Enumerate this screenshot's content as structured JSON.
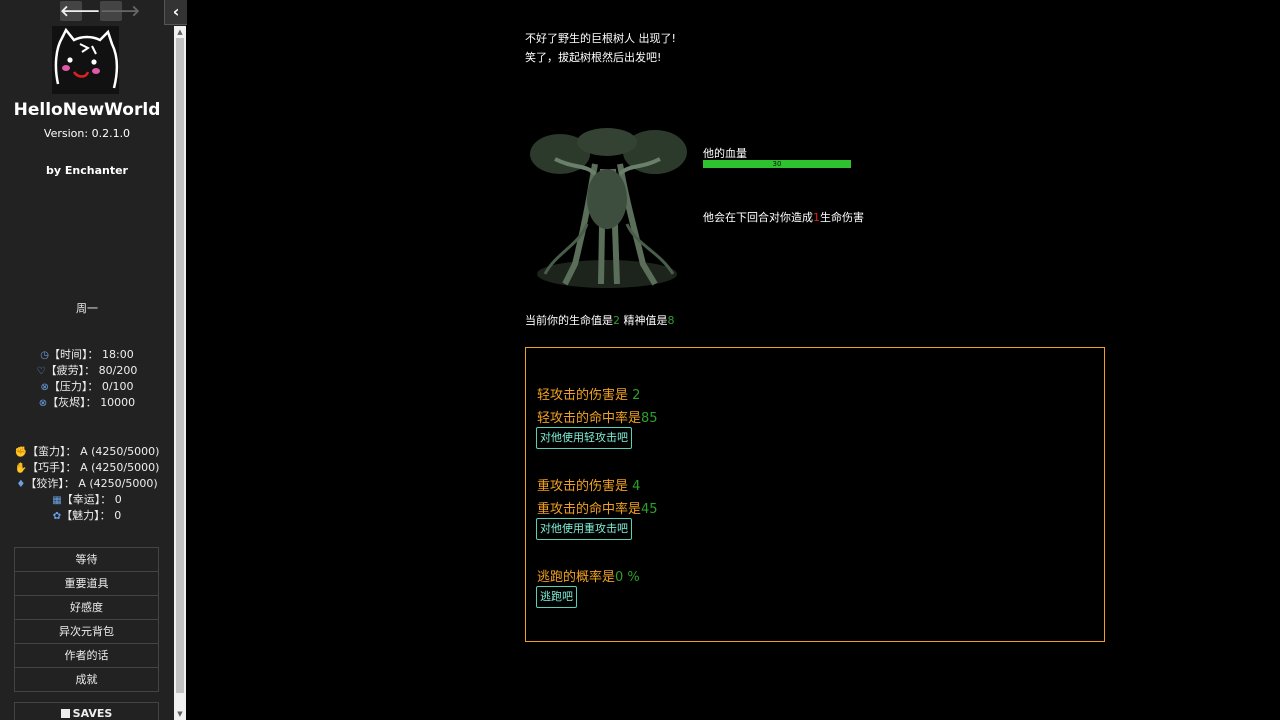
{
  "sidebar": {
    "nav_back": "🡐",
    "nav_forward": "🡒",
    "collapse": "‹",
    "logo_icon": "cat-doodle-logo",
    "title": "HelloNewWorld",
    "version": "Version: 0.2.1.0",
    "author": "by Enchanter",
    "weekday": "周一",
    "stats": [
      {
        "icon": "clock-icon",
        "label": "【时间】：",
        "value": "18:00"
      },
      {
        "icon": "heart-icon",
        "label": "【疲劳】：",
        "value": "80/200"
      },
      {
        "icon": "x-circle-icon",
        "label": "【压力】：",
        "value": "0/100"
      },
      {
        "icon": "x-circle-icon",
        "label": "【灰烬】：",
        "value": "10000"
      }
    ],
    "attrs": [
      {
        "icon": "fist-icon",
        "label": "【蛮力】：",
        "value": "A (4250/5000)"
      },
      {
        "icon": "hand-icon",
        "label": "【巧手】：",
        "value": "A (4250/5000)"
      },
      {
        "icon": "gem-icon",
        "label": "【狡诈】：",
        "value": "A (4250/5000)"
      },
      {
        "icon": "grid-icon",
        "label": "【幸运】：",
        "value": "0"
      },
      {
        "icon": "flower-icon",
        "label": "【魅力】：",
        "value": "0"
      }
    ],
    "menu": [
      "等待",
      "重要道具",
      "好感度",
      "异次元背包",
      "作者的话",
      "成就"
    ],
    "saves": "SAVES"
  },
  "story": {
    "line1": "不好了野生的巨根树人 出现了!",
    "line2": "笑了，拔起树根然后出发吧!"
  },
  "enemy": {
    "hp_label": "他的血量",
    "hp_value": "30",
    "hp_fraction": 1.0,
    "threat_pre": "他会在下回合对你造成",
    "threat_num": "1",
    "threat_post": "生命伤害"
  },
  "player": {
    "pre": "当前你的生命值是",
    "hp": "2",
    "mid": " 精神值是",
    "mp": "8"
  },
  "actions": {
    "light_dmg_label": "轻攻击的伤害是 ",
    "light_dmg": "2",
    "light_hit_label": "轻攻击的命中率是",
    "light_hit": "85",
    "light_btn": "对他使用轻攻击吧",
    "heavy_dmg_label": "重攻击的伤害是 ",
    "heavy_dmg": "4",
    "heavy_hit_label": "重攻击的命中率是",
    "heavy_hit": "45",
    "heavy_btn": "对他使用重攻击吧",
    "flee_label": "逃跑的概率是",
    "flee_val": "0 %",
    "flee_btn": "逃跑吧"
  },
  "colors": {
    "accent_orange": "#f0a020",
    "value_green": "#2ca02c",
    "button_teal": "#58d0b8",
    "hp_bar": "#2ec22e"
  }
}
